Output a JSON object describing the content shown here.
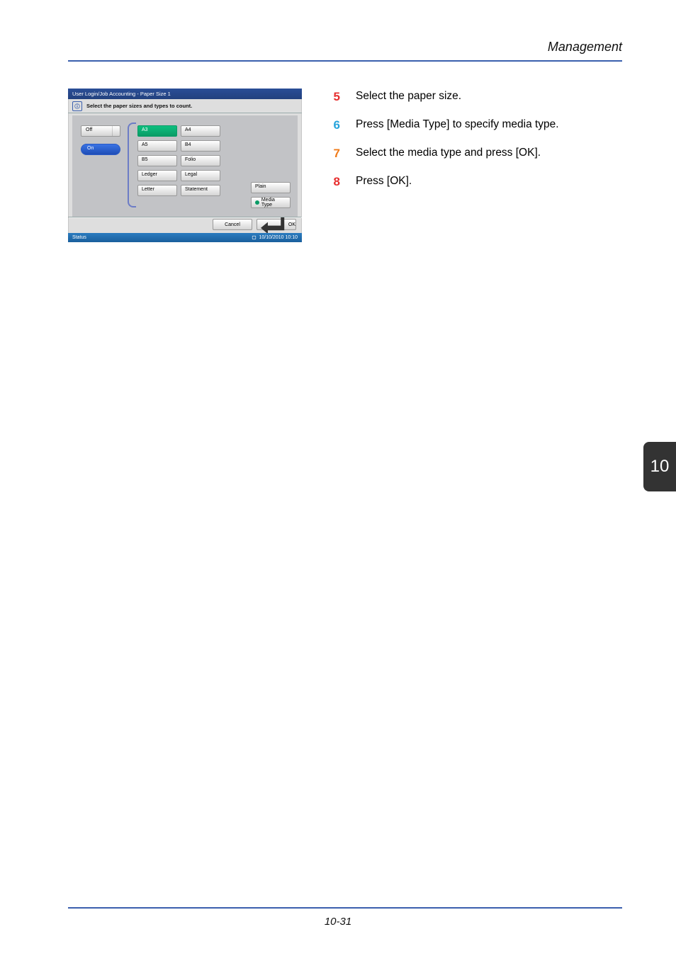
{
  "header": {
    "section": "Management"
  },
  "side_tab": "10",
  "footer": {
    "page_num": "10-31"
  },
  "steps": [
    {
      "n": "5",
      "text": "Select the paper size."
    },
    {
      "n": "6",
      "text": "Press [Media Type] to specify media type."
    },
    {
      "n": "7",
      "text": "Select the media type and press [OK]."
    },
    {
      "n": "8",
      "text": "Press [OK]."
    }
  ],
  "panel": {
    "title": "User Login/Job Accounting - Paper Size 1",
    "instruction": "Select the paper sizes and types to count.",
    "toggle": {
      "off": "Off",
      "on": "On"
    },
    "sizes": [
      "A3",
      "A4",
      "A5",
      "B4",
      "B5",
      "Folio",
      "Ledger",
      "Legal",
      "Letter",
      "Statement"
    ],
    "selected_size": "A3",
    "media_display": "Plain",
    "media_btn": "Media Type",
    "btm": {
      "cancel": "Cancel",
      "ok": "OK"
    },
    "status": {
      "label": "Status",
      "datetime": "10/10/2010  10:10"
    }
  }
}
